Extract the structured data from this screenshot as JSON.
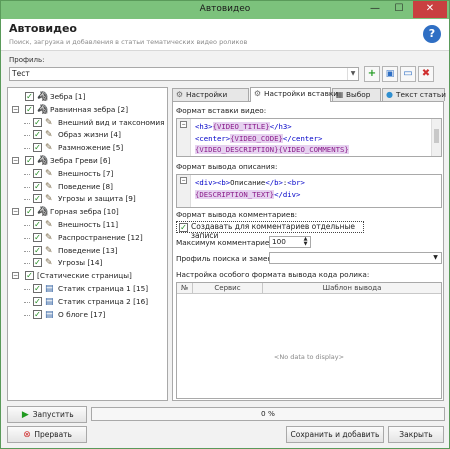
{
  "window": {
    "title": "Автовидео",
    "minimize": "—",
    "maximize": "☐",
    "close": "✕"
  },
  "header": {
    "title": "Автовидео",
    "subtitle": "Поиск, загрузка и добавления в статьи тематических видео роликов"
  },
  "profile": {
    "label": "Профиль:",
    "value": "Тест"
  },
  "tree": [
    {
      "label": "Зебра  [1]",
      "level": 0,
      "expander": "",
      "checked": true,
      "icon": "zebra-icon"
    },
    {
      "label": "Равнинная зебра [2]",
      "level": 0,
      "expander": "−",
      "checked": true,
      "icon": "zebra-icon"
    },
    {
      "label": "Внешний вид и таксономия",
      "level": 1,
      "expander": "",
      "checked": true,
      "icon": "pen-icon"
    },
    {
      "label": "Образ жизни [4]",
      "level": 1,
      "expander": "",
      "checked": true,
      "icon": "pen-icon"
    },
    {
      "label": "Размножение [5]",
      "level": 1,
      "expander": "",
      "checked": true,
      "icon": "pen-icon"
    },
    {
      "label": "Зебра Греви [6]",
      "level": 0,
      "expander": "−",
      "checked": true,
      "icon": "zebra-icon"
    },
    {
      "label": "Внешность [7]",
      "level": 1,
      "expander": "",
      "checked": true,
      "icon": "pen-icon"
    },
    {
      "label": "Поведение [8]",
      "level": 1,
      "expander": "",
      "checked": true,
      "icon": "pen-icon"
    },
    {
      "label": "Угрозы и защита [9]",
      "level": 1,
      "expander": "",
      "checked": true,
      "icon": "pen-icon"
    },
    {
      "label": "Горная зебра [10]",
      "level": 0,
      "expander": "−",
      "checked": true,
      "icon": "zebra-icon"
    },
    {
      "label": "Внешность [11]",
      "level": 1,
      "expander": "",
      "checked": true,
      "icon": "pen-icon"
    },
    {
      "label": "Распространение [12]",
      "level": 1,
      "expander": "",
      "checked": true,
      "icon": "pen-icon"
    },
    {
      "label": "Поведение [13]",
      "level": 1,
      "expander": "",
      "checked": true,
      "icon": "pen-icon"
    },
    {
      "label": "Угрозы [14]",
      "level": 1,
      "expander": "",
      "checked": true,
      "icon": "pen-icon"
    },
    {
      "label": "[Статические страницы]",
      "level": 0,
      "expander": "−",
      "checked": true,
      "icon": ""
    },
    {
      "label": "Статик страница 1 [15]",
      "level": 1,
      "expander": "",
      "checked": true,
      "icon": "page-icon"
    },
    {
      "label": "Статик страница 2 [16]",
      "level": 1,
      "expander": "",
      "checked": true,
      "icon": "page-icon"
    },
    {
      "label": "О блоге [17]",
      "level": 1,
      "expander": "",
      "checked": true,
      "icon": "page-icon"
    }
  ],
  "tabs": [
    {
      "label": "Настройки",
      "icon": "settings-icon",
      "active": false
    },
    {
      "label": "Настройки вставки",
      "icon": "settings-icon",
      "active": true
    },
    {
      "label": "Выбор",
      "icon": "folder-icon",
      "active": false
    },
    {
      "label": "Текст статьи",
      "icon": "globe-icon",
      "active": false
    }
  ],
  "insert_settings": {
    "video_format_label": "Формат вставки видео:",
    "video_format_lines": [
      [
        {
          "t": "tag",
          "v": "<h3>"
        },
        {
          "t": "var",
          "v": "{VIDEO_TITLE}"
        },
        {
          "t": "tag",
          "v": "</h3>"
        }
      ],
      [
        {
          "t": "tag",
          "v": "<center>"
        },
        {
          "t": "var",
          "v": "{VIDEO_CODE}"
        },
        {
          "t": "tag",
          "v": "</center>"
        }
      ],
      [
        {
          "t": "var",
          "v": "{VIDEO_DESCRIPTION}"
        },
        {
          "t": "var",
          "v": "{VIDEO_COMMENTS}"
        }
      ]
    ],
    "description_format_label": "Формат вывода описания:",
    "description_format_lines": [
      [
        {
          "t": "tag",
          "v": "<div>"
        },
        {
          "t": "tag",
          "v": "<b>"
        },
        {
          "t": "txt",
          "v": "Описание"
        },
        {
          "t": "tag",
          "v": "</b>"
        },
        {
          "t": "txt",
          "v": ":"
        },
        {
          "t": "tag",
          "v": "<br>"
        }
      ],
      [
        {
          "t": "var",
          "v": "{DESCRIPTION_TEXT}"
        },
        {
          "t": "tag",
          "v": "</div>"
        }
      ]
    ],
    "comments_format_label": "Формат вывода комментариев:",
    "separate_comments_label": "Создавать для комментариев отдельные записи",
    "separate_comments_checked": true,
    "max_comments_label": "Максимум комментариев:",
    "max_comments_value": "100",
    "search_replace_label": "Профиль поиска и замены:",
    "search_replace_value": "",
    "special_format_label": "Настройка особого формата вывода кода ролика:",
    "grid_columns": [
      "№",
      "Сервис",
      "Шаблон вывода"
    ],
    "grid_empty": "<No data to display>"
  },
  "bottom": {
    "start_label": "Запустить",
    "stop_label": "Прервать",
    "progress_text": "0 %",
    "progress_fraction": 0,
    "save_add_label": "Сохранить и добавить",
    "close_label": "Закрыть"
  }
}
